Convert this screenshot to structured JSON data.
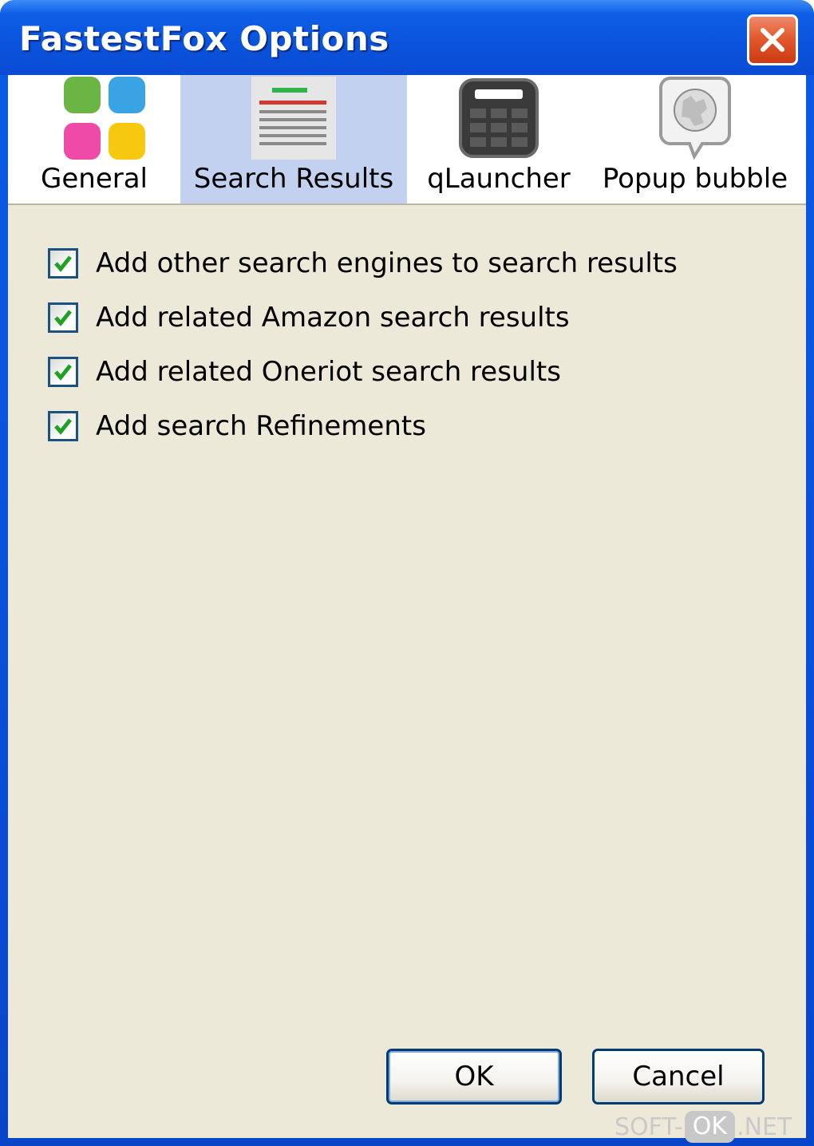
{
  "window": {
    "title": "FastestFox Options"
  },
  "tabs": [
    {
      "id": "general",
      "label": "General",
      "icon": "general-grid-icon",
      "active": false
    },
    {
      "id": "search-results",
      "label": "Search Results",
      "icon": "search-results-icon",
      "active": true
    },
    {
      "id": "qlauncher",
      "label": "qLauncher",
      "icon": "calculator-icon",
      "active": false
    },
    {
      "id": "popup-bubble",
      "label": "Popup bubble",
      "icon": "wikipedia-bubble-icon",
      "active": false
    }
  ],
  "options": [
    {
      "label": "Add other search engines to search results",
      "checked": true
    },
    {
      "label": "Add related Amazon search results",
      "checked": true
    },
    {
      "label": "Add related Oneriot search results",
      "checked": true
    },
    {
      "label": "Add search Refinements",
      "checked": true
    }
  ],
  "buttons": {
    "ok": "OK",
    "cancel": "Cancel"
  },
  "watermark": {
    "prefix": "SOFT-",
    "middle": "OK",
    "suffix": ".NET"
  },
  "colors": {
    "title_bar": "#0a54dd",
    "active_tab": "#c2d1ef",
    "panel": "#ece9d8",
    "close_button": "#e35a2e",
    "check": "#21a121"
  }
}
